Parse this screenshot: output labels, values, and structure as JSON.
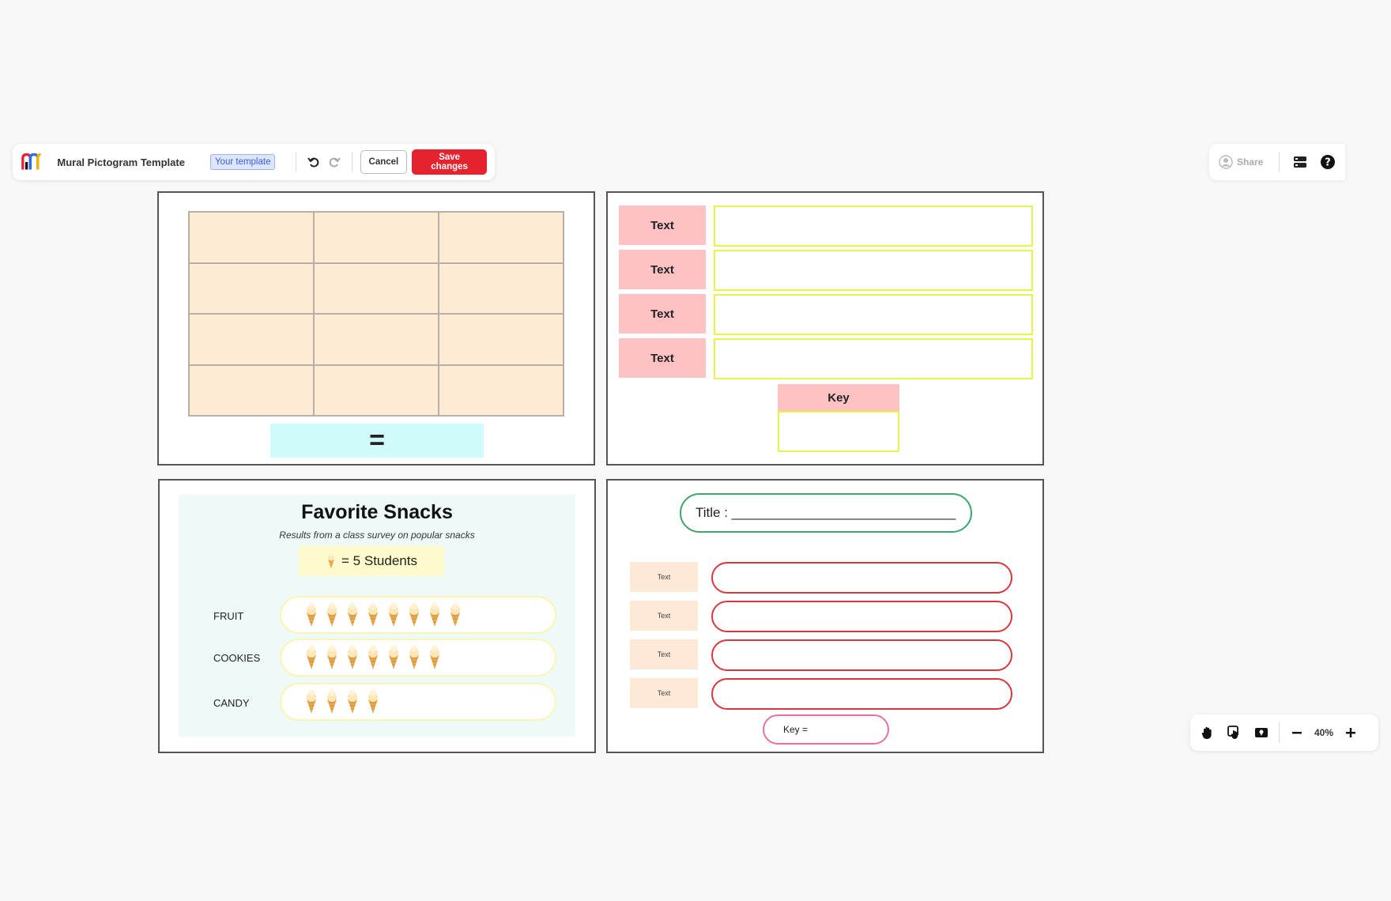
{
  "toolbar": {
    "doc_title": "Mural Pictogram Template",
    "badge": "Your template",
    "undo_icon": "undo-icon",
    "redo_icon": "redo-icon",
    "cancel_label": "Cancel",
    "save_label": "Save changes"
  },
  "right_toolbar": {
    "share_label": "Share",
    "icons": [
      "share-user-icon",
      "outline-icon",
      "help-icon"
    ]
  },
  "zoom": {
    "level": "40%",
    "icons": [
      "hand-icon",
      "select-hand-icon",
      "map-icon",
      "minus-icon",
      "plus-icon"
    ]
  },
  "frame1": {
    "equals": "="
  },
  "frame2": {
    "labels": [
      "Text",
      "Text",
      "Text",
      "Text"
    ],
    "key_label": "Key"
  },
  "frame3": {
    "title": "Favorite Snacks",
    "subtitle": "Results from a class survey on popular snacks",
    "key_text": "= 5 Students",
    "rows": [
      {
        "label": "FRUIT",
        "count": 8
      },
      {
        "label": "COOKIES",
        "count": 7
      },
      {
        "label": "CANDY",
        "count": 4
      }
    ]
  },
  "frame4": {
    "title": "Title : ______________________________",
    "labels": [
      "Text",
      "Text",
      "Text",
      "Text"
    ],
    "key_label": "Key ="
  },
  "colors": {
    "save": "#e5232e",
    "grid_fill": "#fdebd3",
    "equals_fill": "#cffbfb",
    "pink_label": "#ffc2c4",
    "lime_border": "#e3f548",
    "red_border": "#d9363e",
    "green_border": "#3ba56d"
  }
}
